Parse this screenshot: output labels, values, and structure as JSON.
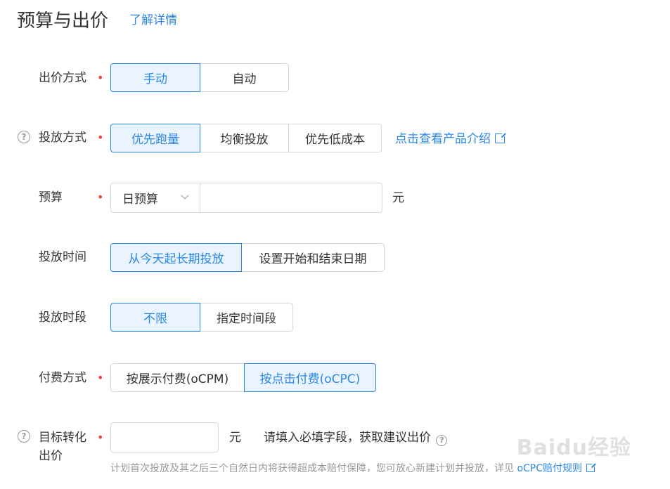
{
  "header": {
    "title": "预算与出价",
    "detail_link": "了解详情"
  },
  "bid_method": {
    "label": "出价方式",
    "required": "•",
    "options": [
      "手动",
      "自动"
    ],
    "selected": "手动"
  },
  "delivery_method": {
    "help_icon": "question-circle-icon",
    "label": "投放方式",
    "required": "•",
    "options": [
      "优先跑量",
      "均衡投放",
      "优先低成本"
    ],
    "selected": "优先跑量",
    "link": "点击查看产品介绍"
  },
  "budget": {
    "label": "预算",
    "required": "•",
    "select_value": "日预算",
    "input_value": "",
    "unit": "元"
  },
  "delivery_time": {
    "label": "投放时间",
    "options": [
      "从今天起长期投放",
      "设置开始和结束日期"
    ],
    "selected": "从今天起长期投放"
  },
  "delivery_period": {
    "label": "投放时段",
    "options": [
      "不限",
      "指定时间段"
    ],
    "selected": "不限"
  },
  "payment_method": {
    "label": "付费方式",
    "required": "•",
    "options": [
      "按展示付费(oCPM)",
      "按点击付费(oCPC)"
    ],
    "selected": "按点击付费(oCPC)"
  },
  "target_bid": {
    "help_icon": "question-circle-icon",
    "label_line1": "目标转化",
    "label_line2": "出价",
    "required": "•",
    "input_value": "",
    "unit": "元",
    "hint": "请填入必填字段，获取建议出价",
    "note": "计划首次投放及其之后三个自然日内将获得超成本赔付保障，您可放心新建计划并投放，详见",
    "note_link": "oCPC赔付规则"
  },
  "watermark": "Baidu经验",
  "colors": {
    "accent": "#2b87e8",
    "active_bg": "#eaf4fe",
    "required": "#f04134"
  }
}
